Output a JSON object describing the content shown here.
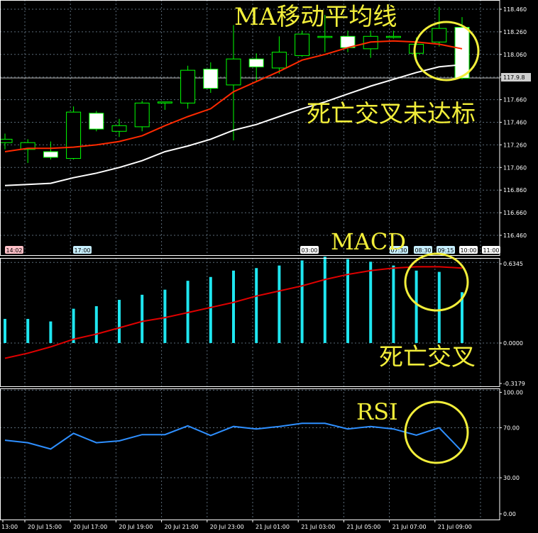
{
  "colors": {
    "background": "#000000",
    "grid": "#5a6a78",
    "axis_text": "#ffffff",
    "candle_outline": "#00ff00",
    "candle_up_fill": "#000000",
    "candle_down_fill": "#ffffff",
    "ma_fast": "#ff2a00",
    "ma_slow": "#ffffff",
    "macd_hist": "#1fe6f0",
    "macd_signal": "#e00000",
    "rsi_line": "#2e8fff",
    "annotation": "#f2ee3a",
    "current_price_tag_bg": "#d0d0d0"
  },
  "chart_data": [
    {
      "type": "candlestick",
      "title": "",
      "ylim": [
        116.3,
        118.6
      ],
      "y_ticks": [
        "118.460",
        "118.260",
        "118.060",
        "117.860",
        "117.660",
        "117.460",
        "117.260",
        "117.060",
        "116.860",
        "116.660",
        "116.460"
      ],
      "current_price_label": "117.9.8",
      "time_markers": [
        "14:02",
        "17:00",
        "03:00",
        "07:30",
        "08:30",
        "09:15",
        "10:00",
        "11:00"
      ],
      "candles": [
        {
          "o": 117.28,
          "h": 117.36,
          "l": 117.22,
          "c": 117.31
        },
        {
          "o": 117.22,
          "h": 117.31,
          "l": 117.1,
          "c": 117.28
        },
        {
          "o": 117.2,
          "h": 117.29,
          "l": 117.13,
          "c": 117.15
        },
        {
          "o": 117.14,
          "h": 117.6,
          "l": 117.13,
          "c": 117.55
        },
        {
          "o": 117.54,
          "h": 117.56,
          "l": 117.38,
          "c": 117.4
        },
        {
          "o": 117.38,
          "h": 117.49,
          "l": 117.33,
          "c": 117.43
        },
        {
          "o": 117.42,
          "h": 117.65,
          "l": 117.38,
          "c": 117.63
        },
        {
          "o": 117.63,
          "h": 117.64,
          "l": 117.57,
          "c": 117.64
        },
        {
          "o": 117.63,
          "h": 117.96,
          "l": 117.58,
          "c": 117.92
        },
        {
          "o": 117.93,
          "h": 117.99,
          "l": 117.72,
          "c": 117.76
        },
        {
          "o": 117.79,
          "h": 118.32,
          "l": 117.3,
          "c": 118.02
        },
        {
          "o": 118.02,
          "h": 118.07,
          "l": 117.82,
          "c": 117.95
        },
        {
          "o": 117.94,
          "h": 118.22,
          "l": 117.89,
          "c": 118.08
        },
        {
          "o": 118.05,
          "h": 118.27,
          "l": 118.04,
          "c": 118.24
        },
        {
          "o": 118.21,
          "h": 118.41,
          "l": 118.08,
          "c": 118.22
        },
        {
          "o": 118.22,
          "h": 118.27,
          "l": 118.08,
          "c": 118.12
        },
        {
          "o": 118.11,
          "h": 118.27,
          "l": 118.03,
          "c": 118.22
        },
        {
          "o": 118.21,
          "h": 118.27,
          "l": 118.2,
          "c": 118.22
        },
        {
          "o": 118.07,
          "h": 118.21,
          "l": 118.0,
          "c": 118.15
        },
        {
          "o": 118.17,
          "h": 118.48,
          "l": 118.13,
          "c": 118.29
        },
        {
          "o": 118.3,
          "h": 118.39,
          "l": 117.84,
          "c": 117.85
        }
      ],
      "ma_fast": [
        117.2,
        117.23,
        117.23,
        117.24,
        117.26,
        117.29,
        117.34,
        117.43,
        117.51,
        117.58,
        117.73,
        117.82,
        117.91,
        118.01,
        118.06,
        118.12,
        118.17,
        118.18,
        118.17,
        118.15,
        118.11
      ],
      "ma_slow": [
        116.9,
        116.91,
        116.92,
        116.97,
        117.01,
        117.06,
        117.12,
        117.2,
        117.25,
        117.31,
        117.39,
        117.44,
        117.51,
        117.58,
        117.64,
        117.71,
        117.78,
        117.84,
        117.9,
        117.95,
        117.97
      ],
      "annotations": [
        "MA移动平均线",
        "死亡交叉未达标"
      ]
    },
    {
      "type": "bar",
      "title": "",
      "ylim": [
        -0.3179,
        0.6345
      ],
      "y_ticks": [
        "0.6345",
        "0.0000",
        "-0.3179"
      ],
      "values": [
        0.19,
        0.19,
        0.17,
        0.27,
        0.29,
        0.34,
        0.38,
        0.42,
        0.49,
        0.52,
        0.57,
        0.59,
        0.61,
        0.65,
        0.68,
        0.66,
        0.64,
        0.61,
        0.57,
        0.56,
        0.4
      ],
      "signal": [
        -0.12,
        -0.08,
        -0.03,
        0.03,
        0.07,
        0.12,
        0.17,
        0.2,
        0.24,
        0.28,
        0.32,
        0.37,
        0.41,
        0.45,
        0.5,
        0.54,
        0.57,
        0.59,
        0.6,
        0.6,
        0.59
      ],
      "annotations": [
        "MACD",
        "死亡交叉"
      ]
    },
    {
      "type": "line",
      "title": "",
      "ylim": [
        0,
        100
      ],
      "y_ticks": [
        "100.00",
        "70.00",
        "30.00",
        "0.00"
      ],
      "values": [
        60.0,
        58.0,
        53.0,
        65.5,
        58.0,
        59.5,
        64.5,
        64.5,
        71.5,
        63.8,
        71.0,
        69.0,
        71.0,
        73.5,
        73.5,
        69.0,
        71.0,
        69.0,
        64.0,
        70.0,
        51.0
      ],
      "annotations": [
        "RSI"
      ]
    }
  ],
  "x_axis": {
    "labels": [
      "13:00",
      "20 Jul 15:00",
      "20 Jul 17:00",
      "20 Jul 19:00",
      "20 Jul 21:00",
      "20 Jul 23:00",
      "21 Jul 01:00",
      "21 Jul 03:00",
      "21 Jul 05:00",
      "21 Jul 07:00",
      "21 Jul 09:00"
    ]
  }
}
